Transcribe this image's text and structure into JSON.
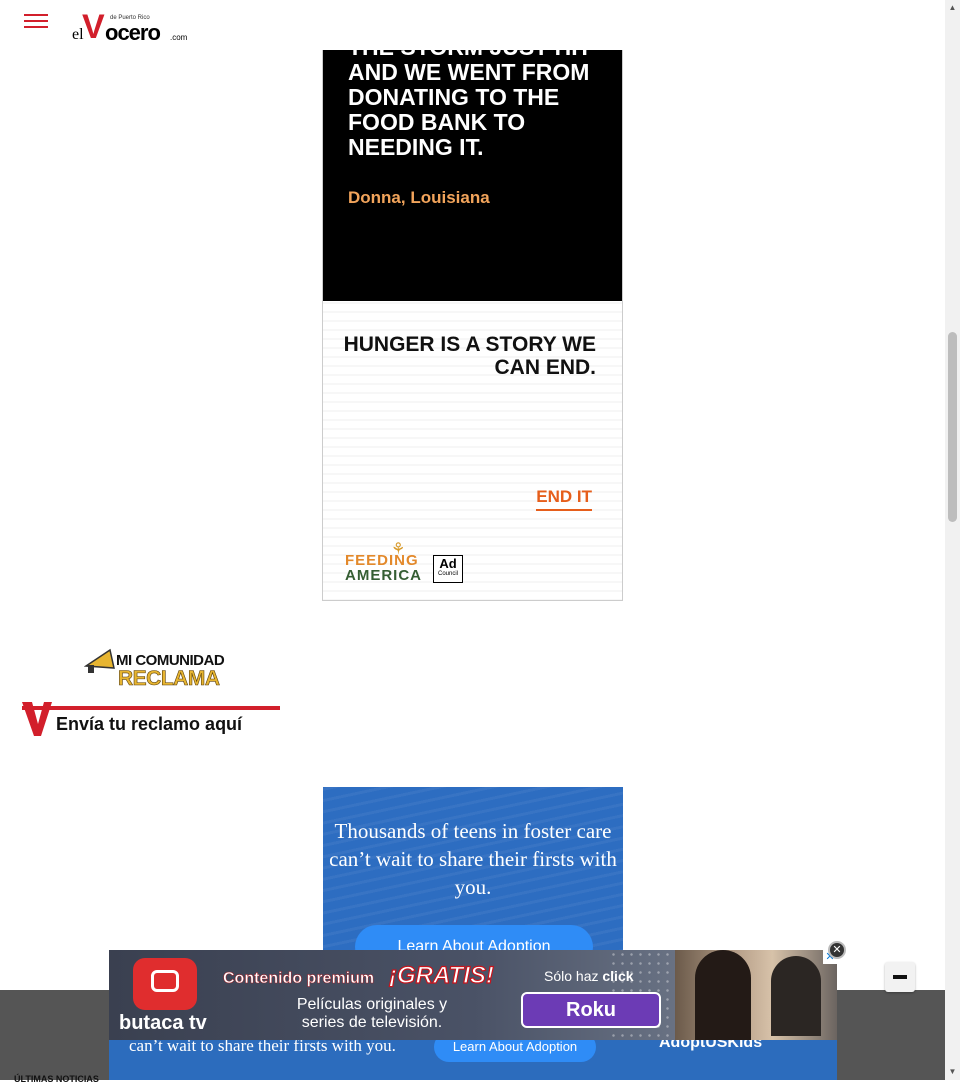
{
  "header": {
    "logo_el": "el",
    "logo_v": "V",
    "logo_ocero": "ocero",
    "logo_dotcom": ".com",
    "logo_tagline": "de Puerto Rico"
  },
  "ad_feeding_america": {
    "headline": "THE STORM JUST HIT AND WE WENT FROM DONATING TO THE FOOD BANK TO NEEDING IT.",
    "location": "Donna, Louisiana",
    "tagline": "HUNGER IS A STORY WE CAN END.",
    "cta": "END IT",
    "brand_line1": "FEEDING",
    "brand_line2": "AMERICA",
    "adcouncil_top": "Ad",
    "adcouncil_bottom": "Council",
    "accent_color": "#e65e1b"
  },
  "reclama": {
    "line1": "MI COMUNIDAD",
    "line2": "RECLAMA",
    "cta": "Envía tu reclamo aquí"
  },
  "ad_adoption": {
    "text": "Thousands of teens in foster care can’t wait to share their firsts with you.",
    "button": "Learn About Adoption",
    "strip_text": "can’t wait to share their firsts with you.",
    "strip_logo": "AdoptUSKids"
  },
  "bottom_label": "ÚLTIMAS NOTICIAS",
  "ad_butaca": {
    "brand": "butaca tv",
    "line1": "Contenido premium",
    "gratis": "¡GRATIS!",
    "solo_haz": "Sólo haz",
    "click": "click",
    "line2_part1": "Películas originales y",
    "line2_part2": "series de televisión.",
    "platform": "Roku",
    "adchoices": "✕",
    "brand_color": "#e02d2e"
  },
  "controls": {
    "close": "✕",
    "minimize_icon": "minus-icon"
  }
}
